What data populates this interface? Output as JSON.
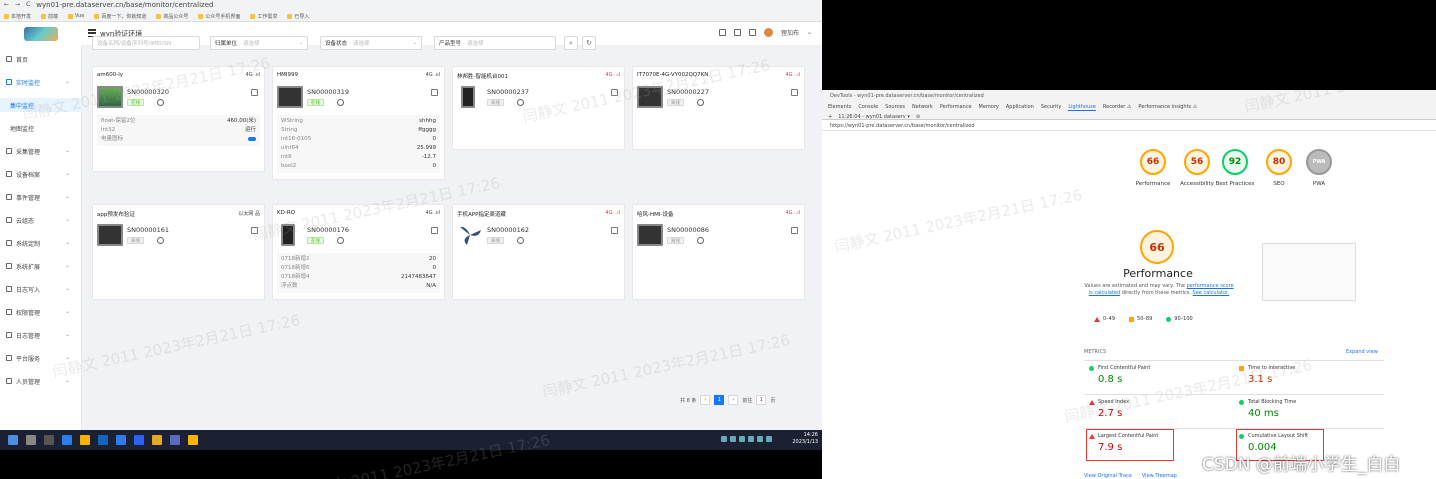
{
  "left": {
    "browser": {
      "url": "wyn01-pre.dataserver.cn/base/monitor/centralized",
      "bookmarks": [
        "本地开发",
        "前端",
        "Vue",
        "百度一下，你就知道",
        "商品公众号",
        "公众号手机界面",
        "工作需求",
        "已导入"
      ]
    },
    "sidebar": {
      "items": [
        {
          "label": "首页"
        },
        {
          "label": "实时监控",
          "open": true
        },
        {
          "label": "集中监控",
          "sub": true,
          "active": true
        },
        {
          "label": "地图监控",
          "sub": true
        },
        {
          "label": "采集管理"
        },
        {
          "label": "设备档案"
        },
        {
          "label": "事件管理"
        },
        {
          "label": "云组态"
        },
        {
          "label": "系统定制"
        },
        {
          "label": "系统扩展"
        },
        {
          "label": "日志写入"
        },
        {
          "label": "权限管理"
        },
        {
          "label": "日志管理"
        },
        {
          "label": "平台服务"
        },
        {
          "label": "人员管理"
        }
      ]
    },
    "header": {
      "title": "wyn验证环境",
      "user": "狸加布"
    },
    "filters": {
      "search_placeholder": "设备名称/设备序列号/IMEI/SN",
      "owner_label": "归属单位",
      "owner_placeholder": "请选择",
      "status_label": "设备状态",
      "status_placeholder": "请选择",
      "model_label": "产品型号",
      "model_placeholder": "请选择",
      "search_icon": "search-icon",
      "reset_icon": "refresh-icon"
    },
    "cards": [
      {
        "title": "am600-ly",
        "signal": "4G .ııl",
        "sn": "SN00000320",
        "status": "在线",
        "online": true,
        "attrs": [
          [
            "float-保留2位",
            "460.00(米)"
          ],
          [
            "int32",
            "运行"
          ],
          [
            "电量图标",
            "toggle"
          ]
        ]
      },
      {
        "title": "HMI999",
        "signal": "4G .ııl",
        "sn": "SN00000319",
        "status": "在线",
        "online": true,
        "attrs": [
          [
            "WString",
            "shhhg"
          ],
          [
            "String",
            "ffgggg"
          ],
          [
            "int16-0105",
            "0"
          ],
          [
            "uint64",
            "25.999"
          ],
          [
            "int8",
            "-12.7"
          ],
          [
            "bool2",
            "0"
          ]
        ]
      },
      {
        "title": "林邦胜-智能机台001",
        "signal": "4G ..ıl",
        "sn": "SN00000237",
        "status": "离线",
        "online": false,
        "attrs": []
      },
      {
        "title": "IT7070E-4G-VY002QQ7KN",
        "signal": "4G ..ıl",
        "sn": "SN00000227",
        "status": "离线",
        "online": false,
        "attrs": []
      },
      {
        "title": "app预发布验证",
        "signal": "以太网 品",
        "sn": "SN00000161",
        "status": "离线",
        "online": false,
        "attrs": []
      },
      {
        "title": "KD-RQ",
        "signal": "4G .ııl",
        "sn": "SN00000176",
        "status": "在线",
        "online": true,
        "attrs": [
          [
            "0718新增2",
            "20"
          ],
          [
            "0718新增6",
            "0"
          ],
          [
            "0718新增4",
            "2147483647"
          ],
          [
            "浮点数",
            "N/A"
          ]
        ]
      },
      {
        "title": "手机APP指定渠道藏",
        "signal": "4G ..ıl",
        "sn": "SN00000162",
        "status": "离线",
        "online": false,
        "attrs": []
      },
      {
        "title": "哈风-HMI-设备",
        "signal": "4G ..ıl",
        "sn": "SN00000086",
        "status": "离线",
        "online": false,
        "attrs": []
      }
    ],
    "pager": {
      "total": "共 8 条",
      "current": "1",
      "goto": "前往",
      "goto_value": "1",
      "page_unit": "页"
    },
    "taskbar": {
      "time": "14:26",
      "date": "2023/1/13"
    },
    "watermark": "闫静文 2011 2023年2月21日 17:26"
  },
  "right": {
    "devtools": {
      "title": "DevTools - wyn01-pre.dataserver.cn/base/monitor/centralized",
      "tabs": [
        "Elements",
        "Console",
        "Sources",
        "Network",
        "Performance",
        "Memory",
        "Application",
        "Security",
        "Lighthouse",
        "Recorder ⚠",
        "Performance insights ⚠"
      ],
      "selected_tab": "Lighthouse",
      "report_select": "11:26:04 - wyn01.dataserv ▾",
      "page_url": "https://wyn01-pre.dataserver.cn/base/monitor/centralized"
    },
    "scores": [
      {
        "value": "66",
        "label": "Performance",
        "tone": "orange"
      },
      {
        "value": "56",
        "label": "Accessibility",
        "tone": "orange"
      },
      {
        "value": "92",
        "label": "Best Practices",
        "tone": "green"
      },
      {
        "value": "80",
        "label": "SEO",
        "tone": "orange"
      },
      {
        "value": "PWA",
        "label": "PWA",
        "tone": "gray"
      }
    ],
    "performance": {
      "score": "66",
      "title": "Performance",
      "desc_1": "Values are estimated and may vary. The ",
      "desc_link1": "performance score is calculated",
      "desc_2": " directly from these metrics. ",
      "desc_link2": "See calculator."
    },
    "legend": [
      {
        "shape": "triangle",
        "label": "0–49"
      },
      {
        "shape": "square",
        "label": "50–89"
      },
      {
        "shape": "circle",
        "label": "90–100"
      }
    ],
    "metrics_label": "METRICS",
    "expand_label": "Expand view",
    "metrics": [
      {
        "name": "First Contentful Paint",
        "value": "0.8 s",
        "tone": "green"
      },
      {
        "name": "Time to Interactive",
        "value": "3.1 s",
        "tone": "orange"
      },
      {
        "name": "Speed Index",
        "value": "2.7 s",
        "tone": "red"
      },
      {
        "name": "Total Blocking Time",
        "value": "40 ms",
        "tone": "green"
      },
      {
        "name": "Largest Contentful Paint",
        "value": "7.9 s",
        "tone": "red"
      },
      {
        "name": "Cumulative Layout Shift",
        "value": "0.004",
        "tone": "green"
      }
    ],
    "footer": {
      "view_original": "View Original Trace",
      "view_treemap": "View Treemap"
    }
  },
  "csdn_credit": "CSDN @前端小学生_白白",
  "colors": {
    "primary": "#1677ff",
    "orange": "#ffa400",
    "green": "#0cce6b",
    "red": "#e33333"
  }
}
